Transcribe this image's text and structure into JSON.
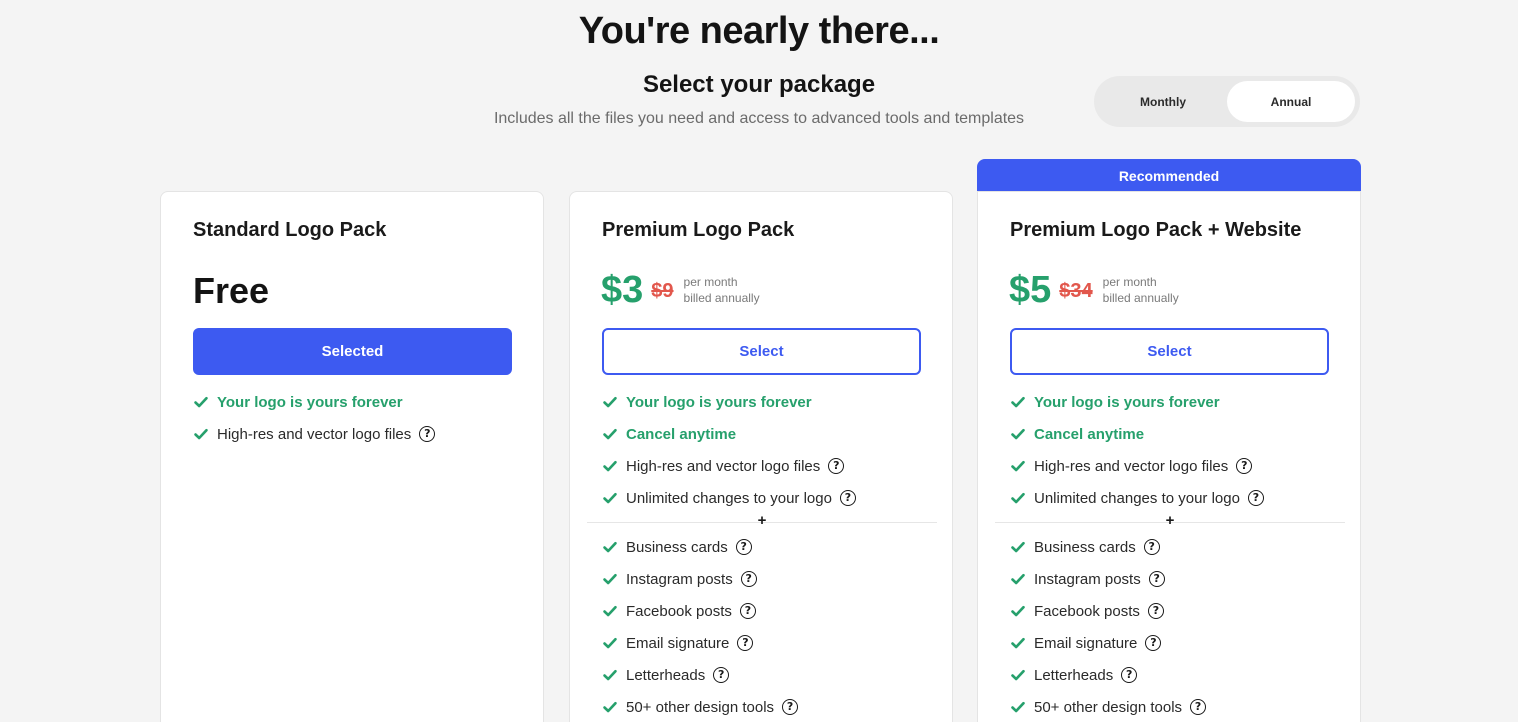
{
  "header": {
    "title": "You're nearly there...",
    "subtitle": "Select your package",
    "description": "Includes all the files you need and access to advanced tools and templates"
  },
  "billing_toggle": {
    "options": [
      "Monthly",
      "Annual"
    ],
    "selected": "Annual"
  },
  "recommended_label": "Recommended",
  "plans": [
    {
      "name": "Standard Logo Pack",
      "price": "Free",
      "button_label": "Selected",
      "features": [
        {
          "text": "Your logo is yours forever",
          "highlight": true,
          "help": false
        },
        {
          "text": "High-res and vector logo files",
          "highlight": false,
          "help": true
        }
      ]
    },
    {
      "name": "Premium Logo Pack",
      "price": "$3",
      "old_price": "$9",
      "price_note_1": "per month",
      "price_note_2": "billed annually",
      "button_label": "Select",
      "features": [
        {
          "text": "Your logo is yours forever",
          "highlight": true,
          "help": false
        },
        {
          "text": "Cancel anytime",
          "highlight": true,
          "help": false
        },
        {
          "text": "High-res and vector logo files",
          "highlight": false,
          "help": true
        },
        {
          "text": "Unlimited changes to your logo",
          "highlight": false,
          "help": true
        }
      ],
      "divider_symbol": "+",
      "extras": [
        {
          "text": "Business cards",
          "help": true
        },
        {
          "text": "Instagram posts",
          "help": true
        },
        {
          "text": "Facebook posts",
          "help": true
        },
        {
          "text": "Email signature",
          "help": true
        },
        {
          "text": "Letterheads",
          "help": true
        },
        {
          "text": "50+ other design tools",
          "help": true
        }
      ]
    },
    {
      "name": "Premium Logo Pack + Website",
      "price": "$5",
      "old_price": "$34",
      "price_note_1": "per month",
      "price_note_2": "billed annually",
      "button_label": "Select",
      "features": [
        {
          "text": "Your logo is yours forever",
          "highlight": true,
          "help": false
        },
        {
          "text": "Cancel anytime",
          "highlight": true,
          "help": false
        },
        {
          "text": "High-res and vector logo files",
          "highlight": false,
          "help": true
        },
        {
          "text": "Unlimited changes to your logo",
          "highlight": false,
          "help": true
        }
      ],
      "divider_symbol": "+",
      "extras": [
        {
          "text": "Business cards",
          "help": true
        },
        {
          "text": "Instagram posts",
          "help": true
        },
        {
          "text": "Facebook posts",
          "help": true
        },
        {
          "text": "Email signature",
          "help": true
        },
        {
          "text": "Letterheads",
          "help": true
        },
        {
          "text": "50+ other design tools",
          "help": true
        }
      ]
    }
  ],
  "colors": {
    "accent_blue": "#3d5af1",
    "price_green": "#26a06c",
    "strike_red": "#e2574c",
    "background": "#f4f4f4"
  },
  "icons": {
    "feature": "check-icon",
    "info": "help-circle-icon"
  }
}
